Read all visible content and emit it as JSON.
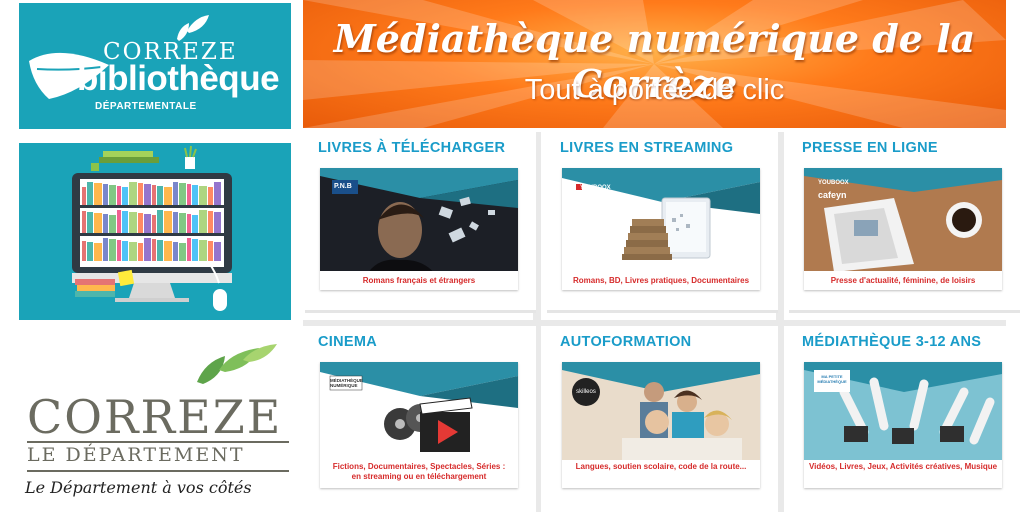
{
  "logo_bibliotheque": {
    "line1": "CORREZE",
    "line2": "bibliothèque",
    "line3": "DÉPARTEMENTALE"
  },
  "banner": {
    "title": "Médiathèque numérique de la Corrèze",
    "subtitle": "Tout à portée de clic"
  },
  "logo_correze": {
    "name": "CORREZE",
    "subtitle": "LE DÉPARTEMENT",
    "slogan": "Le Département à vos côtés"
  },
  "tiles": [
    {
      "heading": "LIVRES À TÉLÉCHARGER",
      "badge": "P.N.B",
      "caption": "Romans français et étrangers",
      "caption2": ""
    },
    {
      "heading": "LIVRES EN STREAMING",
      "badge": "YOUBOOX",
      "caption": "Romans, BD, Livres pratiques, Documentaires",
      "caption2": ""
    },
    {
      "heading": "PRESSE EN LIGNE",
      "badge": "YOUBOOX",
      "badge2": "cafeyn",
      "caption": "Presse d'actualité, féminine, de loisirs",
      "caption2": ""
    },
    {
      "heading": "CINEMA",
      "badge": "MÉDIATHÈQUE NUMÉRIQUE",
      "caption": "Fictions, Documentaires, Spectacles, Séries :",
      "caption2": "en streaming ou en téléchargement"
    },
    {
      "heading": "AUTOFORMATION",
      "badge": "skilleos",
      "caption": "Langues, soutien scolaire, code de la route...",
      "caption2": ""
    },
    {
      "heading": "MÉDIATHÈQUE 3-12 ANS",
      "badge": "MA PETITE MÉDIATHÈQUE",
      "caption": "Vidéos, Livres, Jeux, Activités créatives, Musique",
      "caption2": ""
    }
  ],
  "colors": {
    "teal": "#1aa3b8",
    "heading_blue": "#1a9cc9",
    "caption_red": "#d62b2b",
    "orange": "#ff7a1a",
    "logo_grey": "#6b6b60"
  }
}
